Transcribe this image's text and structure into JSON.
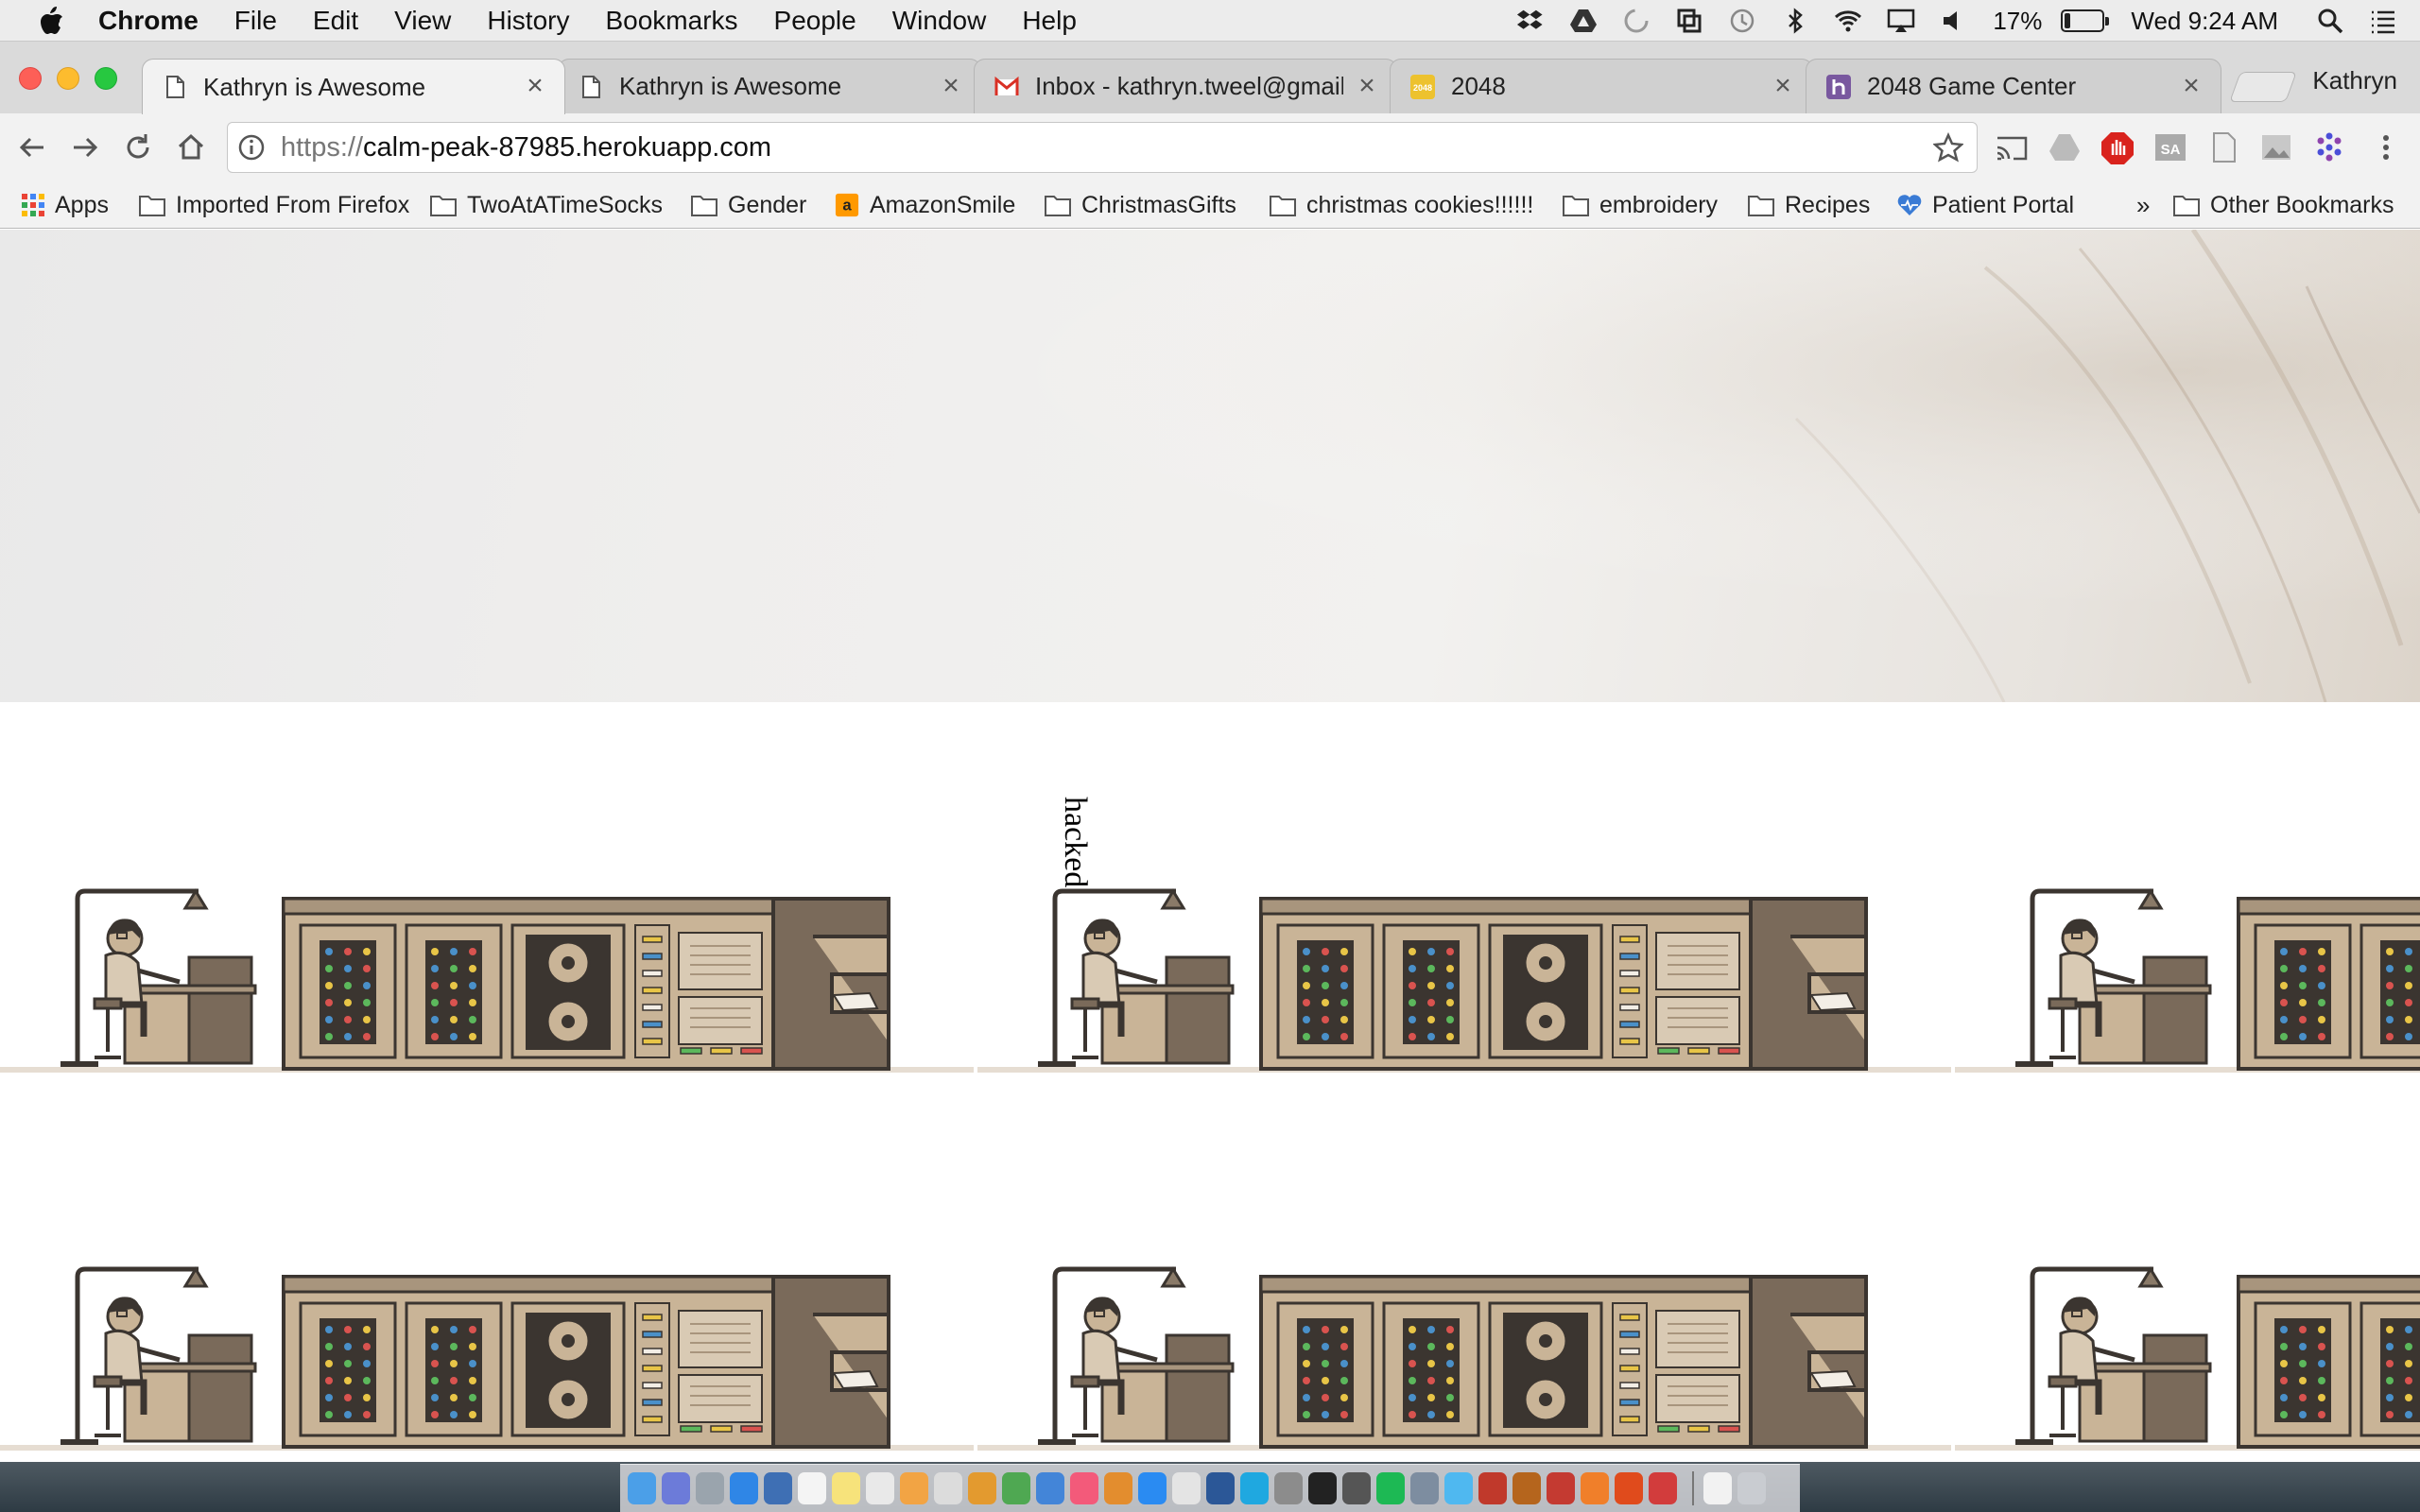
{
  "menubar": {
    "app": "Chrome",
    "menus": [
      "File",
      "Edit",
      "View",
      "History",
      "Bookmarks",
      "People",
      "Window",
      "Help"
    ],
    "battery_text": "17%",
    "battery_level": 0.17,
    "clock": "Wed 9:24 AM",
    "tray_icons": [
      "dropbox-icon",
      "google-drive-icon",
      "sync-icon",
      "crop-icon",
      "time-machine-icon",
      "bluetooth-icon",
      "wifi-icon",
      "airplay-icon",
      "volume-icon"
    ]
  },
  "tabs": [
    {
      "title": "Kathryn is Awesome",
      "icon": "page-icon",
      "active": true
    },
    {
      "title": "Kathryn is Awesome",
      "icon": "page-icon",
      "active": false
    },
    {
      "title": "Inbox - kathryn.tweel@gmail.c",
      "icon": "gmail-icon",
      "active": false
    },
    {
      "title": "2048",
      "icon": "2048-icon",
      "active": false
    },
    {
      "title": "2048 Game Center",
      "icon": "heroku-icon",
      "active": false
    }
  ],
  "favicon_2048_text": "2048",
  "profile": "Kathryn",
  "address": {
    "scheme": "https://",
    "host": "calm-peak-87985.herokuapp.com"
  },
  "bookmarks": {
    "items": [
      {
        "label": "Apps",
        "icon": "apps-grid-icon"
      },
      {
        "label": "Imported From Firefox",
        "icon": "folder-icon"
      },
      {
        "label": "TwoAtATimeSocks",
        "icon": "folder-icon"
      },
      {
        "label": "Gender",
        "icon": "folder-icon"
      },
      {
        "label": "AmazonSmile",
        "icon": "amazon-icon"
      },
      {
        "label": "ChristmasGifts",
        "icon": "folder-icon"
      },
      {
        "label": "christmas cookies!!!!!!",
        "icon": "folder-icon"
      },
      {
        "label": "embroidery",
        "icon": "folder-icon"
      },
      {
        "label": "Recipes",
        "icon": "folder-icon"
      },
      {
        "label": "Patient Portal",
        "icon": "heart-icon"
      }
    ],
    "overflow": "»",
    "other": "Other Bookmarks"
  },
  "page": {
    "rotated_text": "hacked",
    "tile_description": "woman-at-computer-illustration"
  },
  "colors": {
    "machine_body": "#c9b497",
    "machine_dark": "#3b3530",
    "machine_panel": "#7a6a5a",
    "floor": "#e6ddd2",
    "accent_blue": "#4a90c9",
    "accent_red": "#d9534f",
    "accent_yellow": "#e8c547",
    "accent_green": "#5cb85c"
  }
}
